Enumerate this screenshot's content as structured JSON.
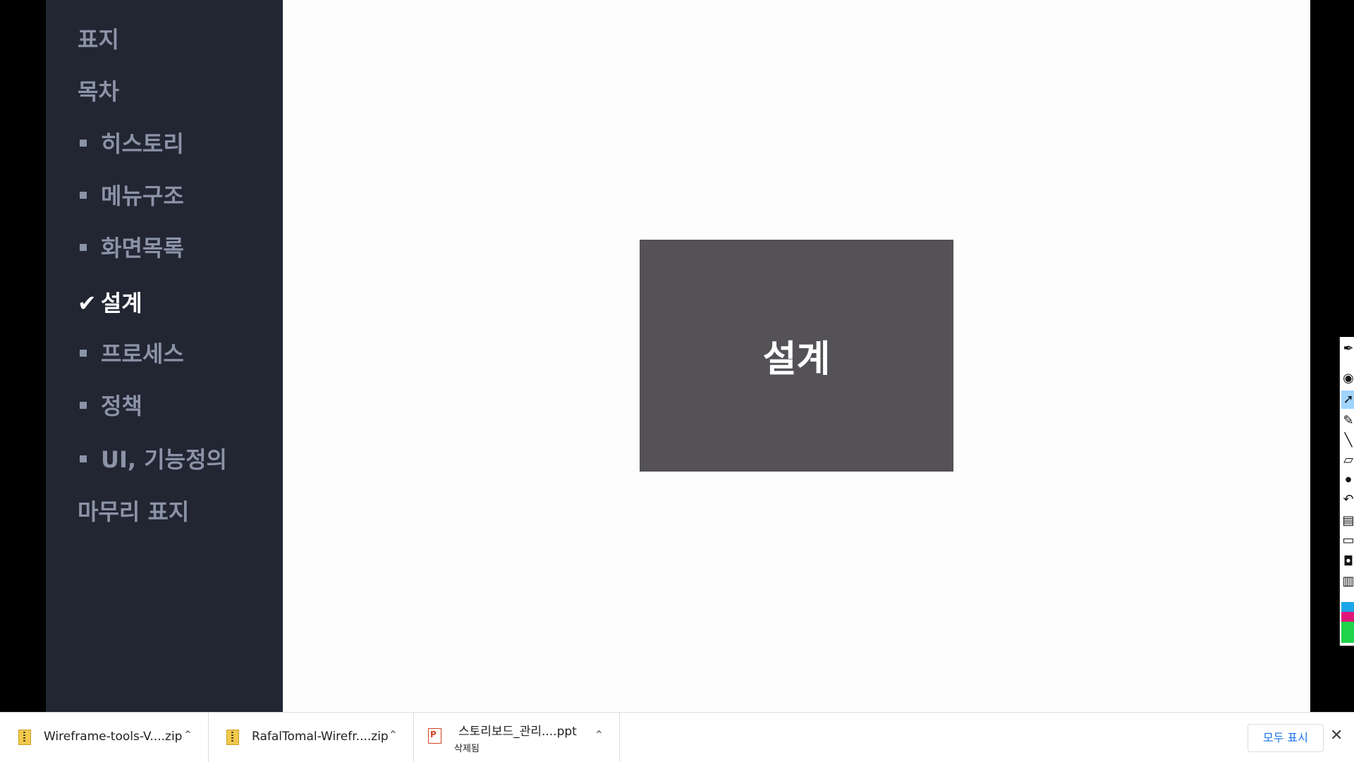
{
  "sidebar": {
    "items": [
      {
        "label": "표지"
      },
      {
        "label": "목차"
      },
      {
        "label": "히스토리"
      },
      {
        "label": "메뉴구조"
      },
      {
        "label": "화면목록"
      },
      {
        "label": "설계",
        "check": "✔"
      },
      {
        "label": "프로세스"
      },
      {
        "label": "정책"
      },
      {
        "label": "UI, 기능정의"
      },
      {
        "label": "마무리 표지"
      }
    ]
  },
  "slide": {
    "title": "설계"
  },
  "downloads": {
    "items": [
      {
        "name": "Wireframe-tools-V....zip",
        "icon": "zip-file-icon"
      },
      {
        "name": "RafalTomal-Wirefr....zip",
        "icon": "zip-file-icon"
      },
      {
        "name": "스토리보드_관리....ppt",
        "status": "삭제됨",
        "icon": "ppt-file-icon"
      }
    ],
    "show_all_label": "모두 표시",
    "close_glyph": "✕",
    "chevron_glyph": "⌃"
  },
  "tools": [
    {
      "icon": "pen-icon"
    },
    {
      "icon": "eye-icon"
    },
    {
      "icon": "cursor-icon"
    },
    {
      "icon": "highlighter-icon"
    },
    {
      "icon": "line-icon"
    },
    {
      "icon": "eraser-icon"
    },
    {
      "icon": "dot-icon"
    },
    {
      "icon": "undo-icon"
    },
    {
      "icon": "trash-icon"
    },
    {
      "icon": "board-icon"
    },
    {
      "icon": "camera-icon"
    },
    {
      "icon": "clipboard-icon"
    }
  ],
  "colors": {
    "sidebar_bg": "#222633",
    "slide_box": "#545257",
    "link_blue": "#1a73e8",
    "swatch_cyan": "#1aa6e8",
    "swatch_magenta": "#e0157a",
    "swatch_green": "#1fd34a"
  }
}
